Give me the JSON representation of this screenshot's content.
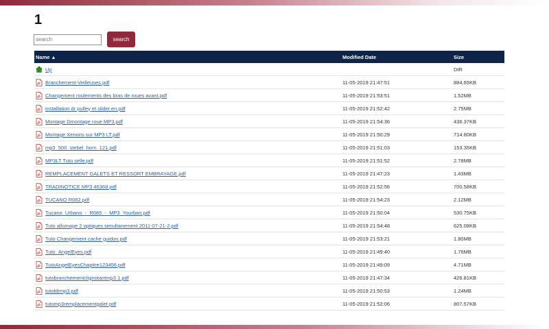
{
  "page": {
    "title": "1"
  },
  "search": {
    "placeholder": "search",
    "button_label": "search"
  },
  "table": {
    "headers": {
      "name": "Name",
      "sort_indicator": "▲",
      "modified": "Modified Date",
      "size": "Size"
    },
    "up_row": {
      "name": "Up",
      "size": "DIR"
    },
    "rows": [
      {
        "name": "Branchement-Veilleuses.pdf",
        "modified": "11-05-2019 21:47:51",
        "size": "884.65KB"
      },
      {
        "name": "Changement roulements des bras de roues avant.pdf",
        "modified": "11-05-2019 21:53:51",
        "size": "1.52MB"
      },
      {
        "name": "installation dr pulley et slider.en.pdf",
        "modified": "11-05-2019 21:52:42",
        "size": "2.75MB"
      },
      {
        "name": "Montage Dmontage roue MP3.pdf",
        "modified": "11-05-2019 21:54:36",
        "size": "436.37KB"
      },
      {
        "name": "Montage Xenons sur MP3 LT.pdf",
        "modified": "11-05-2019 21:50:29",
        "size": "714.60KB"
      },
      {
        "name": "mp3_500_stebel_horn_121.pdf",
        "modified": "11-05-2019 21:51:03",
        "size": "153.35KB"
      },
      {
        "name": "MP3LT Tuto selle.pdf",
        "modified": "11-05-2019 21:51:52",
        "size": "2.78MB"
      },
      {
        "name": "REMPLACEMENT GALETS ET RESSORT EMBRAYAGE.pdf",
        "modified": "11-05-2019 21:47:23",
        "size": "1.43MB"
      },
      {
        "name": "TRADINOTICE MP3 46368.pdf",
        "modified": "11-05-2019 21:52:56",
        "size": "700.58KB"
      },
      {
        "name": "TUCANO R062.pdf",
        "modified": "11-05-2019 21:54:23",
        "size": "2.12MB"
      },
      {
        "name": "Tucano_Urbano_-_R085_-_MP3_Yourban.pdf",
        "modified": "11-05-2019 21:50:04",
        "size": "530.75KB"
      },
      {
        "name": "Tuto allumage 2 optiques simultanement 2011-07-21-2.pdf",
        "modified": "11-05-2019 21:54:48",
        "size": "625.08KB"
      },
      {
        "name": "Tuto Changement cache guidon.pdf",
        "modified": "11-05-2019 21:53:21",
        "size": "1.80MB"
      },
      {
        "name": "Tuto_AngelEyes.pdf",
        "modified": "11-05-2019 21:49:40",
        "size": "1.76MB"
      },
      {
        "name": "TutoAngelEyesChapitre123456.pdf",
        "modified": "11-05-2019 21:49:09",
        "size": "4.71MB"
      },
      {
        "name": "tutobranchementclignotantmp3.1.pdf",
        "modified": "11-05-2019 21:47:34",
        "size": "426.81KB"
      },
      {
        "name": "tutoldrmp3.pdf",
        "modified": "11-05-2019 21:50:53",
        "size": "1.24MB"
      },
      {
        "name": "tutomp3remplacementgalet.pdf",
        "modified": "11-05-2019 21:52:06",
        "size": "807.57KB"
      }
    ]
  },
  "icons": {
    "file": "pdf-file-icon",
    "up": "up-arrow-icon"
  },
  "colors": {
    "accent": "#8e2a3c",
    "header_bg": "#0f2447",
    "link": "#2f5f9e"
  }
}
